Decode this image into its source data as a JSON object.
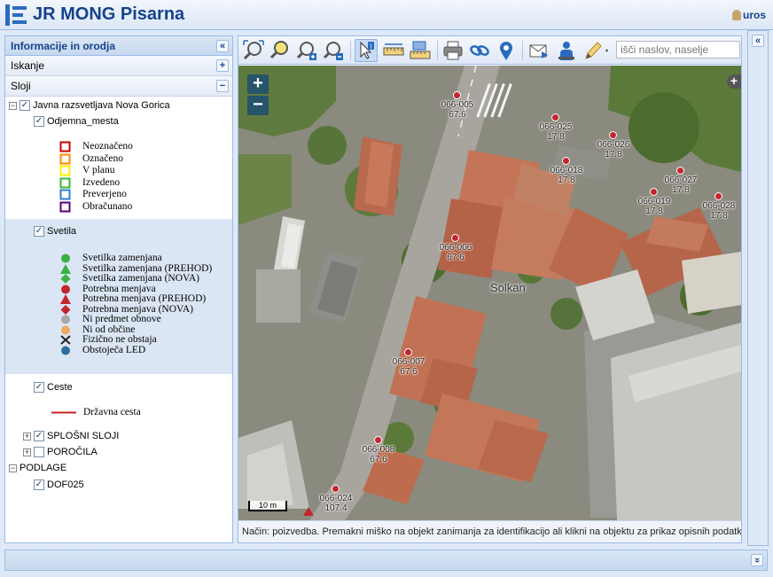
{
  "app": {
    "title": "JR MONG Pisarna",
    "user": "uros"
  },
  "left_panel": {
    "title": "Informacije in orodja",
    "collapse_symbol": "«",
    "sections": {
      "search": "Iskanje",
      "layers": "Sloji",
      "search_toggle": "+",
      "layers_toggle": "−"
    }
  },
  "tree": {
    "root": "Javna razsvetljava Nova Gorica",
    "odjemna": "Odjemna_mesta",
    "odjemna_legend": [
      {
        "label": "Neoznačeno",
        "color": "#cc0000"
      },
      {
        "label": "Označeno",
        "color": "#ff8800"
      },
      {
        "label": "V planu",
        "color": "#ffee00"
      },
      {
        "label": "Izvedeno",
        "color": "#33bb33"
      },
      {
        "label": "Preverjeno",
        "color": "#2f7fd0"
      },
      {
        "label": "Obračunano",
        "color": "#550077"
      }
    ],
    "svetila": "Svetila",
    "svetila_legend": [
      {
        "label": "Svetilka zamenjana",
        "shape": "circle",
        "color": "#3cb043"
      },
      {
        "label": "Svetilka zamenjana (PREHOD)",
        "shape": "triangle",
        "color": "#3cb043"
      },
      {
        "label": "Svetilka zamenjana (NOVA)",
        "shape": "diamond",
        "color": "#3cb043"
      },
      {
        "label": "Potrebna menjava",
        "shape": "circle",
        "color": "#c1272d"
      },
      {
        "label": "Potrebna menjava (PREHOD)",
        "shape": "triangle",
        "color": "#c1272d"
      },
      {
        "label": "Potrebna menjava (NOVA)",
        "shape": "diamond",
        "color": "#c1272d"
      },
      {
        "label": "Ni predmet obnove",
        "shape": "circle",
        "color": "#a8a8a8"
      },
      {
        "label": "Ni od občine",
        "shape": "circle",
        "color": "#f0a860"
      },
      {
        "label": "Fizično ne obstaja",
        "shape": "cross",
        "color": "#222222"
      },
      {
        "label": "Obstoječa LED",
        "shape": "circle",
        "color": "#2e6fa0"
      }
    ],
    "ceste": "Ceste",
    "ceste_legend": {
      "label": "Državna cesta",
      "color": "#cc2222"
    },
    "splosni": "SPLOŠNI SLOJI",
    "porocila": "POROČILA",
    "podlage": "PODLAGE",
    "dof": "DOF025"
  },
  "toolbar": {
    "icons": [
      "zoom-extent-icon",
      "zoom-rectangle-icon",
      "zoom-in-icon",
      "zoom-out-icon",
      "identify-icon",
      "measure-distance-icon",
      "measure-area-icon",
      "print-icon",
      "link-icon",
      "location-pin-icon",
      "send-mail-icon",
      "person-info-icon",
      "pencil-draw-icon"
    ],
    "search_placeholder": "išči naslov, naselje"
  },
  "map": {
    "zoom_in": "+",
    "zoom_out": "−",
    "place_label": "Solkan",
    "scale": "10 m",
    "points": [
      {
        "id": "066-005",
        "value": "67.6"
      },
      {
        "id": "066-025",
        "value": "17.8"
      },
      {
        "id": "066-026",
        "value": "17.8"
      },
      {
        "id": "066-018",
        "value": "17.8"
      },
      {
        "id": "066-027",
        "value": "17.8"
      },
      {
        "id": "066-019",
        "value": "17.8"
      },
      {
        "id": "066-028",
        "value": "17.8"
      },
      {
        "id": "066-006",
        "value": "67.6"
      },
      {
        "id": "066-007",
        "value": "67.6"
      },
      {
        "id": "066-008",
        "value": "67.6"
      },
      {
        "id": "066-024",
        "value": "107.4"
      }
    ],
    "status": "Način: poizvedba. Premakni miško na objekt zanimanja za identifikacijo ali klikni na objektu za prikaz opisnih podatkov."
  },
  "right_panel": {
    "collapse_symbol": "«"
  },
  "footer": {
    "expand_symbol": "»"
  }
}
